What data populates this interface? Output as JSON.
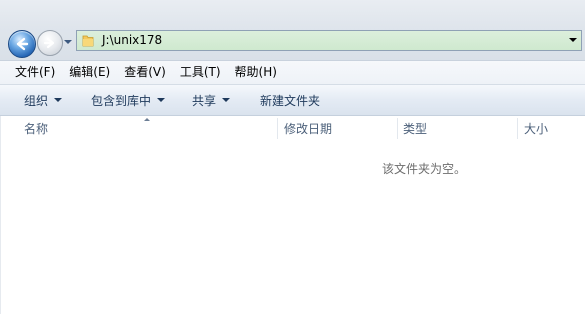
{
  "window": {
    "address_path": "J:\\unix178"
  },
  "icons": {
    "back": "back-arrow-icon",
    "forward": "forward-arrow-icon",
    "recent": "chevron-down-icon",
    "folder": "folder-icon",
    "address_dropdown": "chevron-down-icon"
  },
  "menu": {
    "items": [
      {
        "label": "文件(F)"
      },
      {
        "label": "编辑(E)"
      },
      {
        "label": "查看(V)"
      },
      {
        "label": "工具(T)"
      },
      {
        "label": "帮助(H)"
      }
    ]
  },
  "toolbar": {
    "organize": "组织",
    "include_in_library": "包含到库中",
    "share": "共享",
    "new_folder": "新建文件夹"
  },
  "columns": {
    "name": "名称",
    "date_modified": "修改日期",
    "type": "类型",
    "size": "大小"
  },
  "content": {
    "empty_message": "该文件夹为空。"
  },
  "colors": {
    "address_bg": "#cfe9cf",
    "back_button": "#1f5fb0",
    "toolbar_text": "#1e395b",
    "header_text": "#4c607a"
  }
}
